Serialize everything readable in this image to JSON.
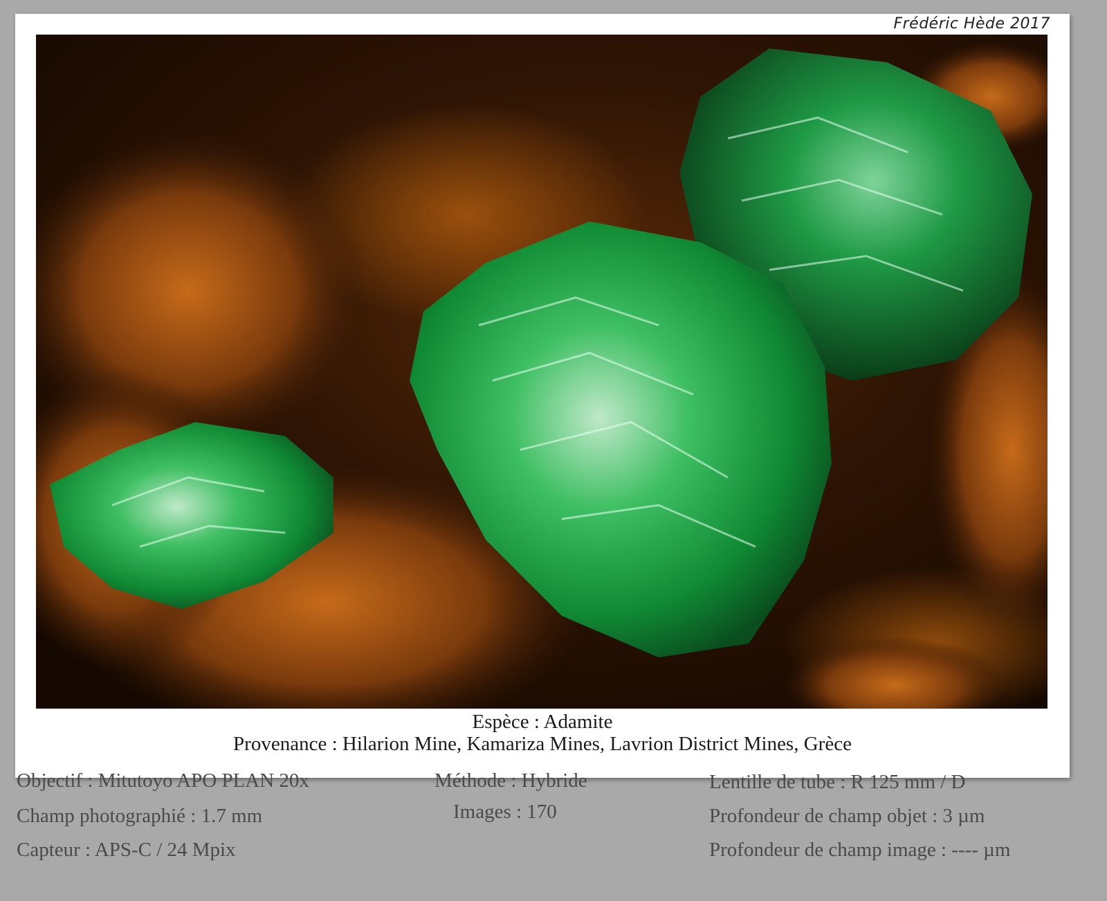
{
  "signature": "Frédéric Hède 2017",
  "caption": {
    "species": "Espèce : Adamite",
    "origin": "Provenance : Hilarion Mine, Kamariza Mines, Lavrion District Mines, Grèce"
  },
  "specs": {
    "col1": [
      "Objectif : Mitutoyo APO PLAN 20x",
      "Champ photographié : 1.7 mm",
      "Capteur : APS-C / 24 Mpix"
    ],
    "col2": [
      "Méthode : Hybride",
      "Images : 170"
    ],
    "col3": [
      "Lentille de tube : R 125 mm / D",
      "Profondeur de champ objet : 3 µm",
      "Profondeur de champ image : ---- µm"
    ]
  },
  "colors": {
    "crystal": "#1fae4a",
    "matrix": "#a8500f",
    "frame": "#a9a9a9"
  }
}
